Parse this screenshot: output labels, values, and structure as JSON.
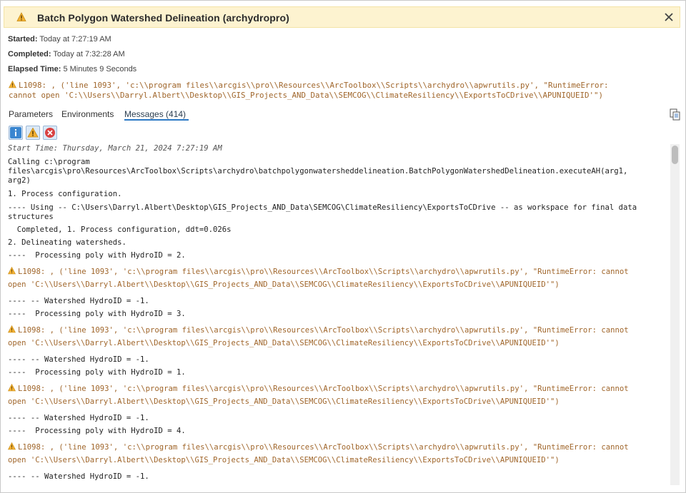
{
  "header": {
    "title": "Batch Polygon Watershed Delineation (archydropro)",
    "icon": "warning-icon",
    "close_icon": "close-icon"
  },
  "meta": {
    "started_label": "Started:",
    "started_value": "Today at 7:27:19 AM",
    "completed_label": "Completed:",
    "completed_value": "Today at 7:32:28 AM",
    "elapsed_label": "Elapsed Time:",
    "elapsed_value": "5 Minutes 9 Seconds"
  },
  "summary_error": {
    "line1": "L1098: , ('line 1093', 'c:\\\\program files\\\\arcgis\\\\pro\\\\Resources\\\\ArcToolbox\\\\Scripts\\\\archydro\\\\apwrutils.py', \"RuntimeError:",
    "line2": "cannot open 'C:\\\\Users\\\\Darryl.Albert\\\\Desktop\\\\GIS_Projects_AND_Data\\\\SEMCOG\\\\ClimateResiliency\\\\ExportsToCDrive\\\\APUNIQUEID'\")"
  },
  "tabs": [
    {
      "label": "Parameters"
    },
    {
      "label": "Environments"
    },
    {
      "label": "Messages (414)"
    }
  ],
  "filters": [
    "info-filter",
    "warning-filter",
    "error-filter"
  ],
  "log": {
    "start": "Start Time: Thursday, March 21, 2024 7:27:19 AM",
    "calling1": "Calling c:\\program",
    "calling2": "files\\arcgis\\pro\\Resources\\ArcToolbox\\Scripts\\archydro\\batchpolygonwatersheddelineation.BatchPolygonWatershedDelineation.executeAH(arg1,",
    "calling3": "arg2)",
    "step1": "1. Process configuration.",
    "using1": "---- Using -- C:\\Users\\Darryl.Albert\\Desktop\\GIS_Projects_AND_Data\\SEMCOG\\ClimateResiliency\\ExportsToCDrive -- as workspace for final data",
    "using2": "structures",
    "completed1": "  Completed, 1. Process configuration, ddt=0.026s",
    "step2": "2. Delineating watersheds.",
    "proc2": "----  Processing poly with HydroID = 2.",
    "warn_a": "L1098: , ('line 1093', 'c:\\\\program files\\\\arcgis\\\\pro\\\\Resources\\\\ArcToolbox\\\\Scripts\\\\archydro\\\\apwrutils.py', \"RuntimeError: cannot",
    "warn_b": "open 'C:\\\\Users\\\\Darryl.Albert\\\\Desktop\\\\GIS_Projects_AND_Data\\\\SEMCOG\\\\ClimateResiliency\\\\ExportsToCDrive\\\\APUNIQUEID'\")",
    "ws": "---- -- Watershed HydroID = -1.",
    "proc3": "----  Processing poly with HydroID = 3.",
    "proc1": "----  Processing poly with HydroID = 1.",
    "proc4": "----  Processing poly with HydroID = 4."
  },
  "colors": {
    "header_bg": "#fdf3d0",
    "warning_text": "#a0662b",
    "tab_underline": "#2b78c5"
  }
}
